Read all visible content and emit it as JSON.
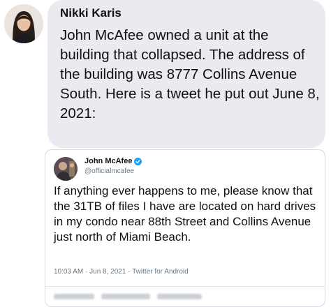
{
  "post": {
    "author": "Nikki Karis",
    "text": "John McAfee owned a unit at the building that collapsed. The address of the building was 8777 Collins Avenue South. Here is a tweet he put out June 8, 2021:"
  },
  "embedded_tweet": {
    "name": "John McAfee",
    "handle": "@officialmcafee",
    "verified": true,
    "text": "If anything ever happens to me, please know that the 31TB of files I have are located on hard drives in my condo near 88th Street and Collins Avenue just north of Miami Beach.",
    "meta": "10:03 AM · Jun 8, 2021 · Twitter for Android"
  },
  "colors": {
    "bubble_background": "#e9ebf0",
    "verified_badge": "#1da1f2",
    "handle_text": "#657786"
  },
  "icons": {
    "verified": "verified-badge-icon"
  }
}
